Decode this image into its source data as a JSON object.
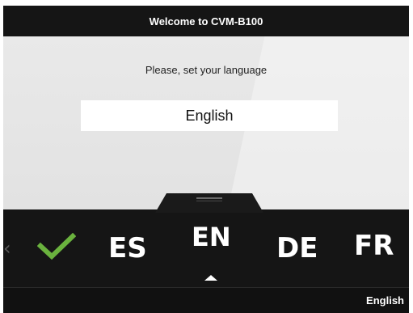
{
  "header": {
    "title": "Welcome to CVM-B100"
  },
  "content": {
    "prompt": "Please, set your language",
    "selected_language": "English"
  },
  "selector": {
    "confirm_icon": "checkmark-icon",
    "options": [
      {
        "code": "ES"
      },
      {
        "code": "EN",
        "selected": true
      },
      {
        "code": "DE"
      },
      {
        "code": "FR"
      }
    ],
    "accent_color": "#6ab23e"
  },
  "status": {
    "language": "English"
  }
}
